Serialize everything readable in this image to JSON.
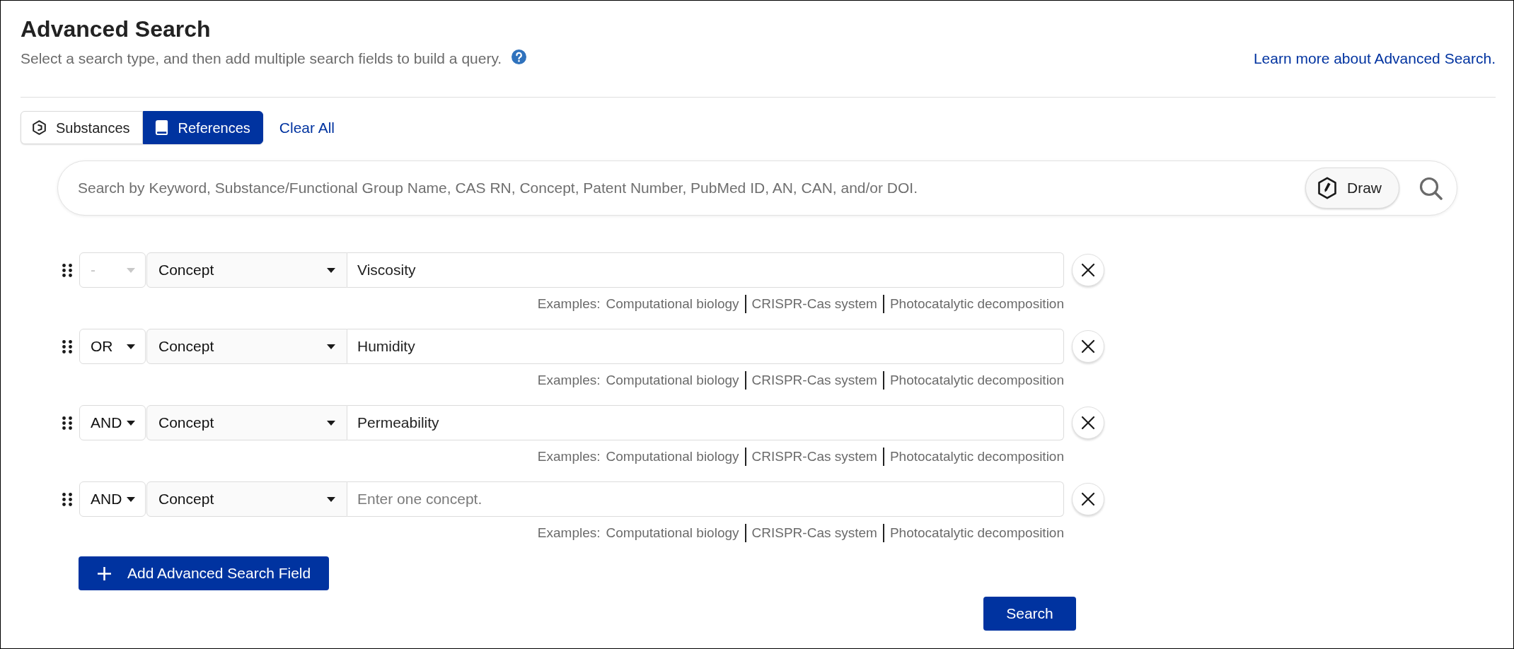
{
  "header": {
    "title": "Advanced Search",
    "subtitle": "Select a search type, and then add multiple search fields to build a query.",
    "help_link": "Learn more about Advanced Search."
  },
  "search_type_tabs": [
    {
      "label": "Substances",
      "kind": "substance",
      "selected": false
    },
    {
      "label": "References",
      "kind": "reference",
      "selected": true
    }
  ],
  "clear_all": "Clear All",
  "search_bar": {
    "placeholder": "Search by Keyword, Substance/Functional Group Name, CAS RN, Concept, Patent Number, PubMed ID, AN, CAN, and/or DOI.",
    "draw_button": "Draw"
  },
  "fields": [
    {
      "operator": "-",
      "operator_disabled": true,
      "field_type": "Concept",
      "value": "Viscosity",
      "examples_label": "Examples:",
      "examples": [
        "Computational biology",
        "CRISPR-Cas system",
        "Photocatalytic decomposition"
      ]
    },
    {
      "operator": "OR",
      "operator_disabled": false,
      "field_type": "Concept",
      "value": "Humidity",
      "examples_label": "Examples:",
      "examples": [
        "Computational biology",
        "CRISPR-Cas system",
        "Photocatalytic decomposition"
      ]
    },
    {
      "operator": "AND",
      "operator_disabled": false,
      "field_type": "Concept",
      "value": "Permeability",
      "examples_label": "Examples:",
      "examples": [
        "Computational biology",
        "CRISPR-Cas system",
        "Photocatalytic decomposition"
      ]
    },
    {
      "operator": "AND",
      "operator_disabled": false,
      "field_type": "Concept",
      "placeholder": "Enter one concept.",
      "examples_label": "Examples:",
      "examples": [
        "Computational biology",
        "CRISPR-Cas system",
        "Photocatalytic decomposition"
      ]
    }
  ],
  "add_field_button": "Add Advanced Search Field",
  "search_button": "Search"
}
